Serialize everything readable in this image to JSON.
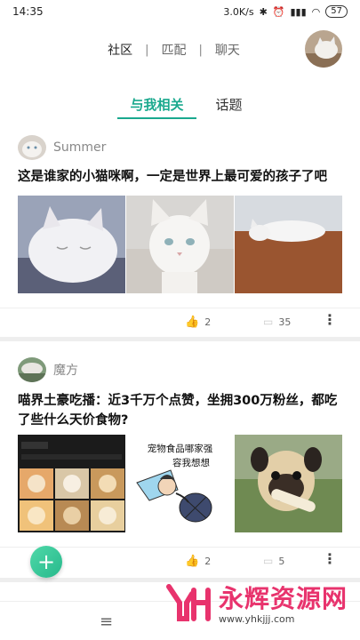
{
  "status": {
    "time": "14:35",
    "speed": "3.0K/s",
    "battery": "57"
  },
  "nav": {
    "community": "社区",
    "sep1": "|",
    "match": "匹配",
    "sep2": "|",
    "chat": "聊天"
  },
  "tabs": [
    {
      "label": "与我相关"
    },
    {
      "label": "话题"
    }
  ],
  "posts": [
    {
      "username": "Summer",
      "title": "这是谁家的小猫咪啊，一定是世界上最可爱的孩子了吧",
      "likes": "2",
      "comments": "35"
    },
    {
      "username": "魔方",
      "title": "喵界土豪吃播：近3千万个点赞，坐拥300万粉丝，都吃了些什么天价食物?",
      "likes": "2",
      "comments": "5",
      "image_text": {
        "line1": "宠物食品哪家强",
        "line2": "容我想想"
      }
    }
  ],
  "fab": {
    "label": "+"
  },
  "watermark": {
    "main": "永辉资源网",
    "sub": "www.yhkjjj.com"
  },
  "colors": {
    "accent": "#1aa98e",
    "watermark": "#e8336d"
  }
}
